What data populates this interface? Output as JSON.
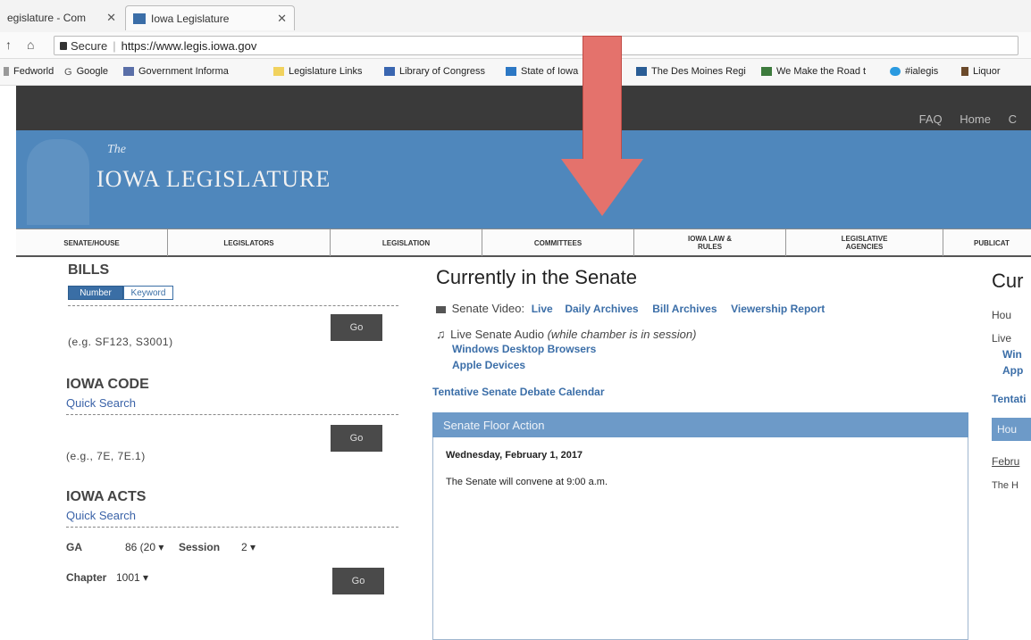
{
  "browser": {
    "tabs": [
      {
        "label": "egislature - Com",
        "close": "✕"
      },
      {
        "label": "Iowa Legislature",
        "close": "✕"
      }
    ],
    "secure_label": "Secure",
    "url": "https://www.legis.iowa.gov",
    "bookmarks": [
      "Fedworld",
      "Google",
      "Government Informa",
      "Legislature Links",
      "Library of Congress",
      "State of Iowa",
      "The Des Moines Regi",
      "We Make the Road t",
      "#ialegis",
      "Liquor"
    ]
  },
  "site": {
    "top_links": [
      "FAQ",
      "Home",
      "C"
    ],
    "logo_the": "The",
    "logo": "IOWA LEGISLATURE",
    "nav": [
      "SENATE/HOUSE",
      "LEGISLATORS",
      "LEGISLATION",
      "COMMITTEES",
      "IOWA LAW & RULES",
      "LEGISLATIVE AGENCIES",
      "PUBLICAT"
    ]
  },
  "left": {
    "bills_title": "BILLS",
    "bills_tab_number": "Number",
    "bills_tab_keyword": "Keyword",
    "go": "Go",
    "bills_hint": "(e.g. SF123, S3001)",
    "code_title": "IOWA CODE",
    "code_sub": "Quick Search",
    "code_hint": "(e.g., 7E, 7E.1)",
    "acts_title": "IOWA ACTS",
    "acts_sub": "Quick Search",
    "ga_label": "GA",
    "ga_value": "86 (20 ▾",
    "session_label": "Session",
    "session_value": "2   ▾",
    "chapter_label": "Chapter",
    "chapter_value": "1001  ▾"
  },
  "senate": {
    "title": "Currently in the Senate",
    "video_label": "Senate Video:",
    "video_links": [
      "Live",
      "Daily Archives",
      "Bill Archives",
      "Viewership Report"
    ],
    "audio_label": "Live Senate Audio",
    "audio_note": "(while chamber is in session)",
    "audio_links": [
      "Windows Desktop Browsers",
      "Apple Devices"
    ],
    "calendar": "Tentative Senate Debate Calendar",
    "floor_title": "Senate Floor Action",
    "floor_date": "Wednesday, February 1, 2017",
    "floor_text": "The Senate will convene at 9:00 a.m."
  },
  "house": {
    "title": "Cur",
    "video": "Hou",
    "audio": "Live",
    "link1": "Win",
    "link2": "App",
    "calendar": "Tentati",
    "floor_title": "Hou",
    "floor_date": "Febru",
    "floor_text": "The H"
  }
}
